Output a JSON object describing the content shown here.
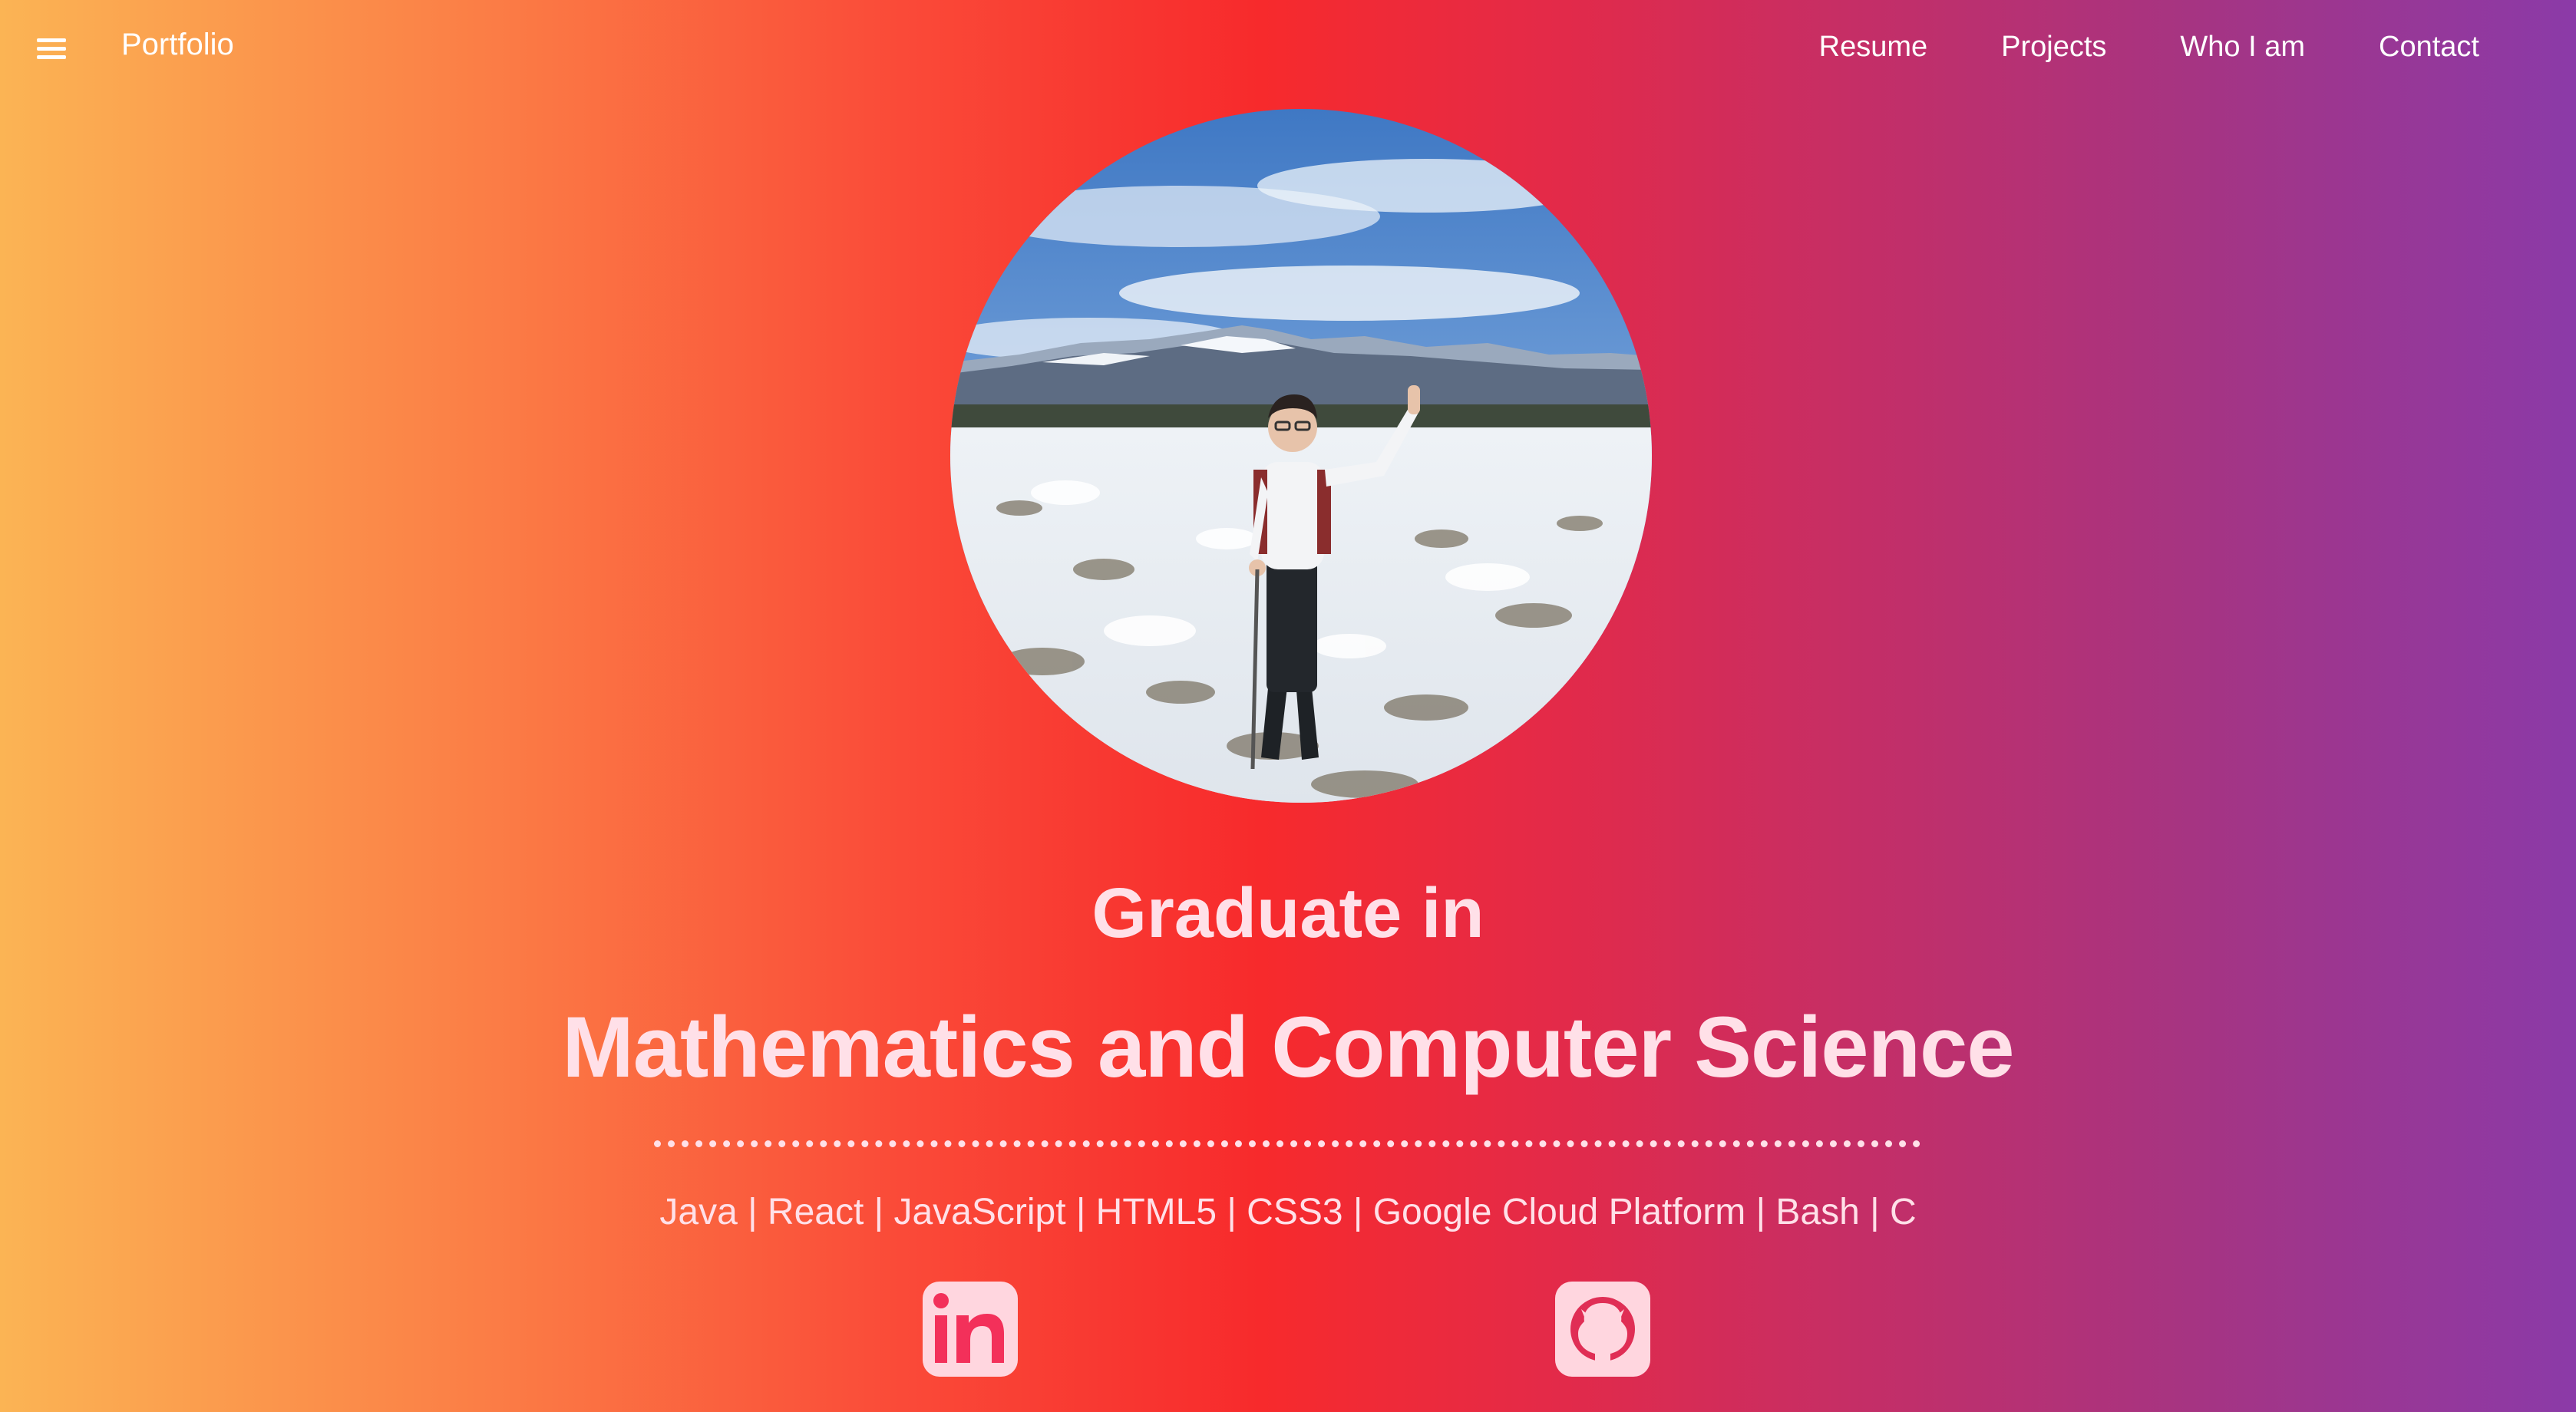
{
  "navbar": {
    "brand": "Portfolio",
    "links": [
      "Resume",
      "Projects",
      "Who I am",
      "Contact"
    ]
  },
  "hero": {
    "photo_icon": "profile-photo",
    "title_line1": "Graduate in",
    "title_line2": "Mathematics and Computer Science",
    "skills": "Java | React | JavaScript | HTML5 | CSS3 | Google Cloud Platform | Bash | C"
  },
  "social": {
    "linkedin_icon": "linkedin-icon",
    "github_icon": "github-icon"
  },
  "colors": {
    "gradient_start": "#fbb454",
    "gradient_mid": "#f72a2c",
    "gradient_end": "#8b3aa8",
    "text": "#ffe0e8"
  }
}
